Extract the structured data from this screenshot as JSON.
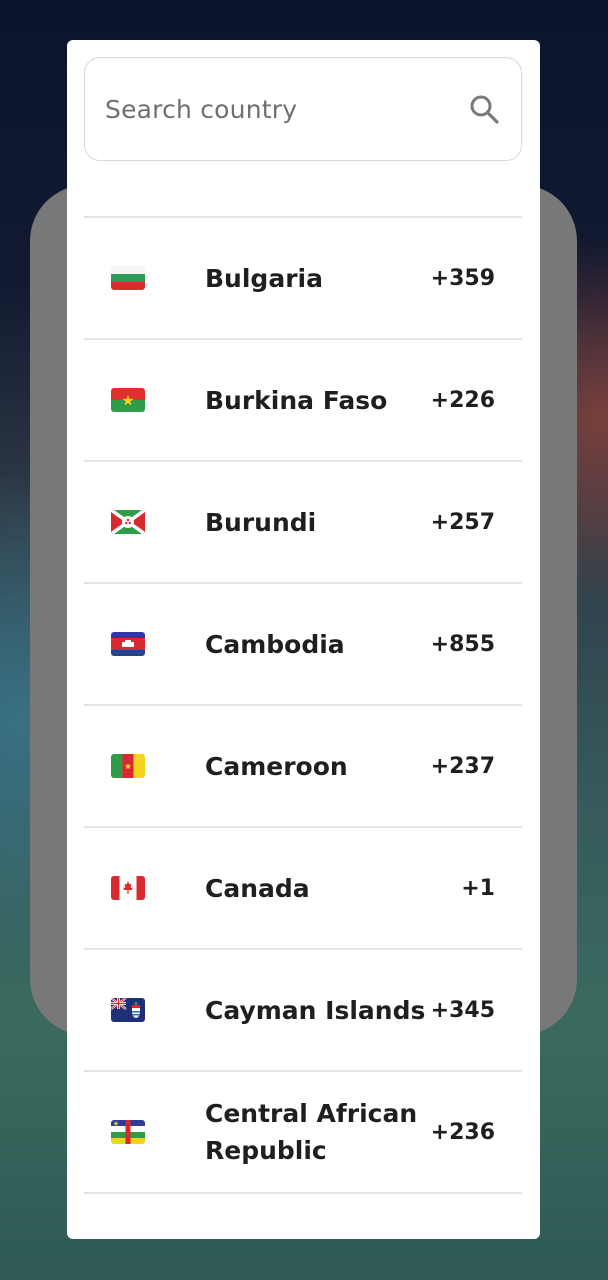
{
  "search": {
    "placeholder": "Search country",
    "icon": "search-icon"
  },
  "countries": [
    {
      "name": "Bulgaria",
      "code": "+359",
      "flag": "bulgaria-flag-icon"
    },
    {
      "name": "Burkina Faso",
      "code": "+226",
      "flag": "burkina-faso-flag-icon"
    },
    {
      "name": "Burundi",
      "code": "+257",
      "flag": "burundi-flag-icon"
    },
    {
      "name": "Cambodia",
      "code": "+855",
      "flag": "cambodia-flag-icon"
    },
    {
      "name": "Cameroon",
      "code": "+237",
      "flag": "cameroon-flag-icon"
    },
    {
      "name": "Canada",
      "code": "+1",
      "flag": "canada-flag-icon"
    },
    {
      "name": "Cayman Islands",
      "code": "+345",
      "flag": "cayman-islands-flag-icon"
    },
    {
      "name": "Central African Republic",
      "code": "+236",
      "flag": "central-african-republic-flag-icon"
    }
  ],
  "colors": {
    "dialog_background": "#ffffff",
    "divider": "#e4e4e4",
    "text": "#1f1f1f",
    "placeholder": "#6f6f6f",
    "overlay_card": "#777878"
  }
}
